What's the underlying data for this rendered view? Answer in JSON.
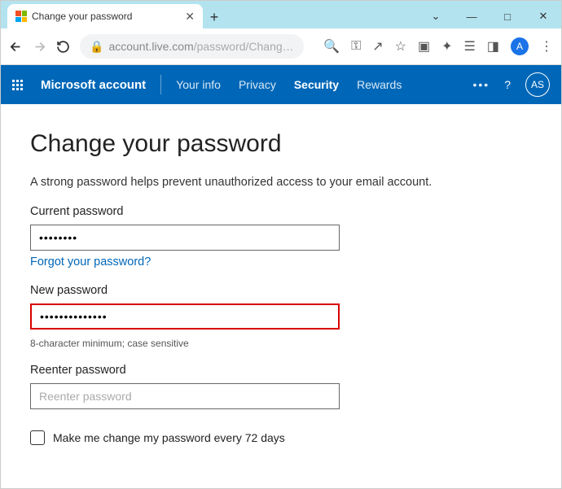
{
  "browser": {
    "tab_title": "Change your password",
    "url_host": "account.live.com",
    "url_path": "/password/Chang…",
    "avatar_letter": "A"
  },
  "header": {
    "brand": "Microsoft account",
    "nav": {
      "your_info": "Your info",
      "privacy": "Privacy",
      "security": "Security",
      "rewards": "Rewards"
    },
    "avatar_initials": "AS"
  },
  "page": {
    "title": "Change your password",
    "description": "A strong password helps prevent unauthorized access to your email account.",
    "current_label": "Current password",
    "current_value": "••••••••",
    "forgot_link": "Forgot your password?",
    "new_label": "New password",
    "new_value": "••••••••••••••",
    "hint": "8-character minimum; case sensitive",
    "reenter_label": "Reenter password",
    "reenter_placeholder": "Reenter password",
    "checkbox_label": "Make me change my password every 72 days"
  }
}
